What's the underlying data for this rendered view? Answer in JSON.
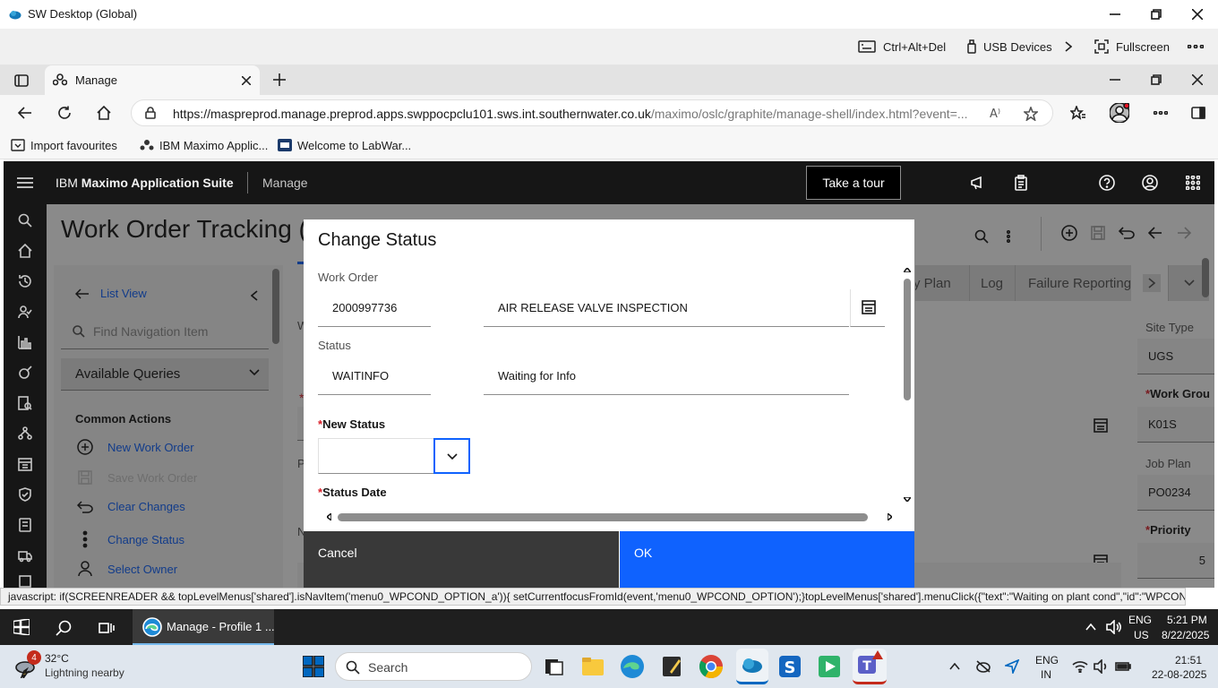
{
  "remote_window": {
    "title": "SW Desktop (Global)",
    "toolbar": {
      "ctrl_alt_del": "Ctrl+Alt+Del",
      "usb_devices": "USB Devices",
      "fullscreen": "Fullscreen"
    }
  },
  "browser": {
    "tab_title": "Manage",
    "url_host": "https://maspreprod.manage.preprod.apps.swppocpclu101.sws.int.southernwater.co.uk",
    "url_path": "/maximo/oslc/graphite/manage-shell/index.html?event=...",
    "favorites": [
      "Import favourites",
      "IBM Maximo Applic...",
      "Welcome to LabWar..."
    ]
  },
  "maximo": {
    "brand_prefix": "IBM",
    "brand_name": "Maximo Application Suite",
    "app_name": "Manage",
    "take_tour": "Take a tour",
    "page_title": "Work Order Tracking (",
    "tabs": [
      "y Plan",
      "Log",
      "Failure Reporting"
    ],
    "nav": {
      "list_view": "List View",
      "find_placeholder": "Find Navigation Item",
      "available_queries": "Available Queries",
      "common_actions": "Common Actions",
      "actions": [
        "New Work Order",
        "Save Work Order",
        "Clear Changes",
        "Change Status",
        "Select Owner"
      ]
    },
    "right_fields": {
      "site_type_label": "Site Type",
      "site_type_value": "UGS",
      "work_group_label": "Work Grou",
      "work_group_value": "K01S",
      "job_plan_label": "Job Plan",
      "job_plan_value": "PO0234",
      "priority_label": "Priority",
      "priority_value": "5"
    },
    "side_letters": [
      "W",
      "P",
      "N"
    ]
  },
  "modal": {
    "title": "Change Status",
    "work_order_label": "Work Order",
    "work_order_value": "2000997736",
    "work_order_desc": "AIR RELEASE VALVE INSPECTION",
    "status_label": "Status",
    "status_value": "WAITINFO",
    "status_desc": "Waiting for Info",
    "new_status_label": "New Status",
    "status_date_label": "Status Date",
    "cancel": "Cancel",
    "ok": "OK"
  },
  "status_bar": "javascript: if(SCREENREADER && topLevelMenus['shared'].isNavItem('menu0_WPCOND_OPTION_a')){ setCurrentfocusFromId(event,'menu0_WPCOND_OPTION');}topLevelMenus['shared'].menuClick({\"text\":\"Waiting on plant cond\",\"id\":\"WPCOND_O...",
  "remote_taskbar": {
    "app_label": "Manage - Profile 1 ...",
    "lang": "ENG",
    "region": "US",
    "time": "5:21 PM",
    "date": "8/22/2025"
  },
  "local_taskbar": {
    "weather_temp": "32°C",
    "weather_desc": "Lightning nearby",
    "weather_badge": "4",
    "search_label": "Search",
    "lang": "ENG",
    "region": "IN",
    "time": "21:51",
    "date": "22-08-2025"
  },
  "colors": {
    "primary": "#0f62fe",
    "header": "#161616",
    "cancel_bg": "#393939"
  }
}
